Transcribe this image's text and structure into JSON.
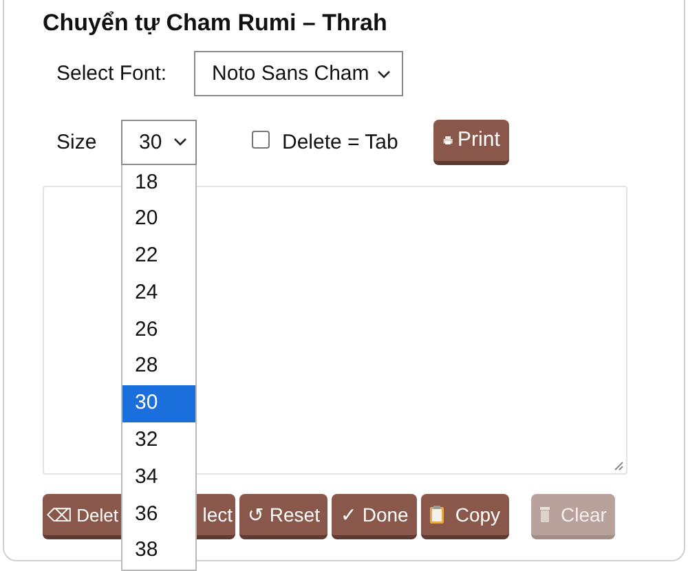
{
  "title": "Chuyển tự Cham Rumi – Thrah",
  "font": {
    "label": "Select Font:",
    "value": "Noto Sans Cham"
  },
  "size": {
    "label": "Size",
    "value": "30",
    "options": [
      {
        "label": "18",
        "selected": false
      },
      {
        "label": "20",
        "selected": false
      },
      {
        "label": "22",
        "selected": false
      },
      {
        "label": "24",
        "selected": false
      },
      {
        "label": "26",
        "selected": false
      },
      {
        "label": "28",
        "selected": false
      },
      {
        "label": "30",
        "selected": true
      },
      {
        "label": "32",
        "selected": false
      },
      {
        "label": "34",
        "selected": false
      },
      {
        "label": "36",
        "selected": false
      },
      {
        "label": "38",
        "selected": false
      }
    ]
  },
  "delete_tab": {
    "label": "Delete = Tab",
    "checked": false
  },
  "print_button": {
    "label": "Print"
  },
  "buttons": [
    {
      "kind": "char",
      "icon": "⌫",
      "label": "Delet",
      "disabled": false
    },
    {
      "kind": "plain",
      "label": "lect",
      "disabled": false
    },
    {
      "kind": "char",
      "icon": "↺",
      "label": "Reset",
      "disabled": false
    },
    {
      "kind": "char",
      "icon": "✓",
      "label": "Done",
      "disabled": false
    },
    {
      "kind": "clipboard",
      "label": "Copy",
      "disabled": false
    },
    {
      "kind": "trash",
      "label": "Clear",
      "disabled": true
    }
  ]
}
